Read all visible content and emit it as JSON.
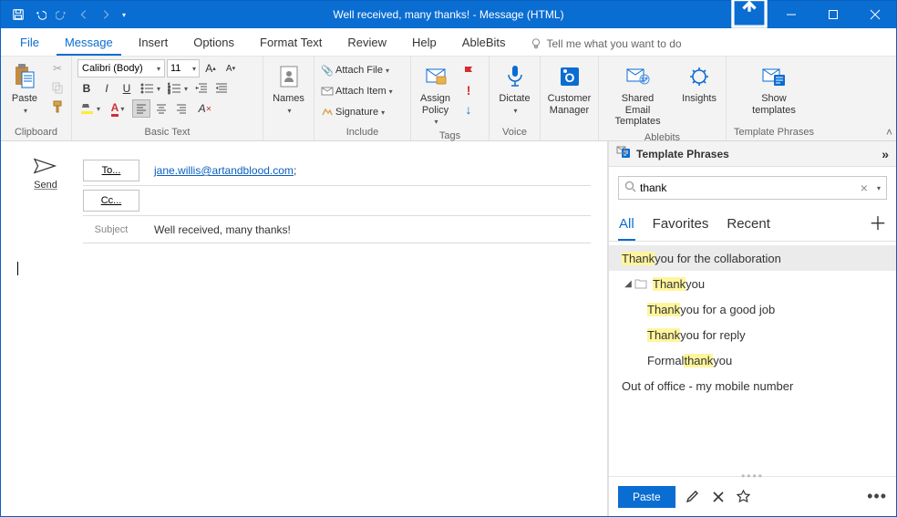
{
  "window": {
    "title": "Well received, many thanks!  -  Message (HTML)"
  },
  "menu": {
    "file": "File",
    "message": "Message",
    "insert": "Insert",
    "options": "Options",
    "format_text": "Format Text",
    "review": "Review",
    "help": "Help",
    "ablebits": "AbleBits",
    "tell_me": "Tell me what you want to do"
  },
  "ribbon": {
    "clipboard": {
      "label": "Clipboard",
      "paste": "Paste"
    },
    "basic_text": {
      "label": "Basic Text",
      "font_name": "Calibri (Body)",
      "font_size": "11"
    },
    "names": {
      "label": "Names",
      "names_btn": "Names"
    },
    "include": {
      "label": "Include",
      "attach_file": "Attach File",
      "attach_item": "Attach Item",
      "signature": "Signature"
    },
    "tags": {
      "label": "Tags",
      "assign_policy": "Assign\nPolicy"
    },
    "voice": {
      "label": "Voice",
      "dictate": "Dictate"
    },
    "cm": {
      "customer_manager": "Customer\nManager"
    },
    "ablebits": {
      "label": "Ablebits",
      "shared": "Shared Email\nTemplates",
      "insights": "Insights"
    },
    "tp": {
      "label": "Template Phrases",
      "show": "Show\ntemplates"
    }
  },
  "compose": {
    "send": "Send",
    "to_label": "To...",
    "cc_label": "Cc...",
    "subject_label": "Subject",
    "to_value": "jane.willis@artandblood.com",
    "subject_value": "Well received, many thanks!"
  },
  "pane": {
    "title": "Template Phrases",
    "search_value": "thank",
    "tabs": {
      "all": "All",
      "favorites": "Favorites",
      "recent": "Recent"
    },
    "items": [
      {
        "pre": "",
        "hl": "Thank",
        "post": " you for the collaboration"
      },
      {
        "pre": "",
        "hl": "Thank",
        "post": " you"
      },
      {
        "pre": "",
        "hl": "Thank",
        "post": " you for a good job"
      },
      {
        "pre": "",
        "hl": "Thank",
        "post": " you for reply"
      },
      {
        "pre": "Formal ",
        "hl": "thank",
        "post": " you"
      }
    ],
    "extra": "Out of office - my mobile number",
    "paste": "Paste"
  }
}
